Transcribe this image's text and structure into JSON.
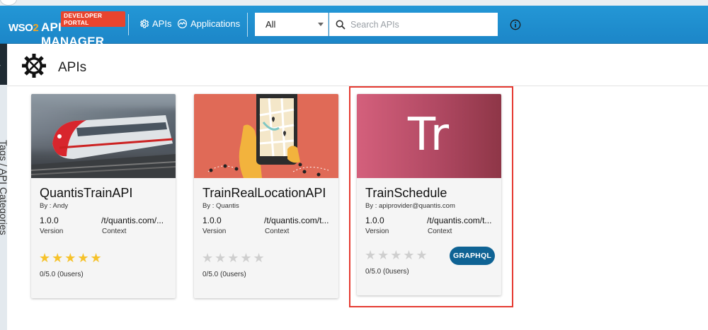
{
  "header": {
    "portal_badge": "DEVELOPER PORTAL",
    "logo_wso": "WSO",
    "logo_2": "2",
    "logo_product": "API MANAGER",
    "nav": [
      {
        "label": "APIs",
        "icon": "gear-icon"
      },
      {
        "label": "Applications",
        "icon": "applications-icon"
      }
    ],
    "search_scope": "All",
    "search_placeholder": "Search APIs",
    "accent": "#1c8bcf"
  },
  "sidebar": {
    "label": "Tags / API Categories"
  },
  "page": {
    "title": "APIs"
  },
  "cards": [
    {
      "name": "QuantisTrainAPI",
      "by": "By : Andy",
      "version": "1.0.0",
      "version_label": "Version",
      "context": "/t/quantis.com/...",
      "context_label": "Context",
      "stars": "★★★★★",
      "rating": "0/5.0 (0users)"
    },
    {
      "name": "TrainRealLocationAPI",
      "by": "By : Quantis",
      "version": "1.0.0",
      "version_label": "Version",
      "context": "/t/quantis.com/t...",
      "context_label": "Context",
      "stars": "★★★★★",
      "rating": "0/5.0 (0users)"
    },
    {
      "name": "TrainSchedule",
      "thumb_text": "Tr",
      "by": "By : apiprovider@quantis.com",
      "version": "1.0.0",
      "version_label": "Version",
      "context": "/t/quantis.com/t...",
      "context_label": "Context",
      "stars": "★★★★★",
      "rating": "0/5.0 (0users)",
      "badge": "GRAPHQL"
    }
  ]
}
